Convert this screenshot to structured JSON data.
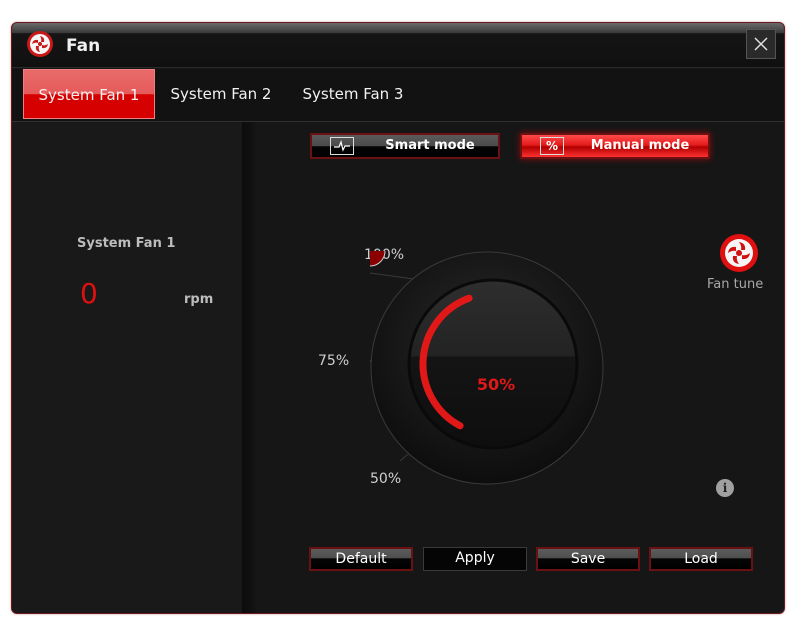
{
  "window": {
    "title": "Fan",
    "app_icon": "fan-logo-icon",
    "close_icon": "close-icon"
  },
  "tabs": [
    {
      "label": "System Fan 1",
      "active": true
    },
    {
      "label": "System Fan 2",
      "active": false
    },
    {
      "label": "System Fan 3",
      "active": false
    }
  ],
  "status": {
    "fan_name": "System Fan 1",
    "rpm": "0",
    "unit": "rpm"
  },
  "modes": {
    "smart": {
      "label": "Smart mode",
      "icon": "waveform-icon",
      "active": false
    },
    "manual": {
      "label": "Manual mode",
      "icon": "percent-icon",
      "icon_text": "%",
      "active": true
    }
  },
  "dial": {
    "value_percent": 50,
    "value_label": "50%",
    "min": 50,
    "max": 100,
    "ticks": [
      "100%",
      "75%",
      "50%"
    ]
  },
  "fan_tune": {
    "label": "Fan tune",
    "icon": "fan-tune-icon"
  },
  "info": {
    "icon": "info-icon",
    "glyph": "i"
  },
  "actions": {
    "default": "Default",
    "apply": "Apply",
    "save": "Save",
    "load": "Load"
  },
  "colors": {
    "accent": "#e01010",
    "background": "#161616",
    "border": "#6b1114"
  }
}
